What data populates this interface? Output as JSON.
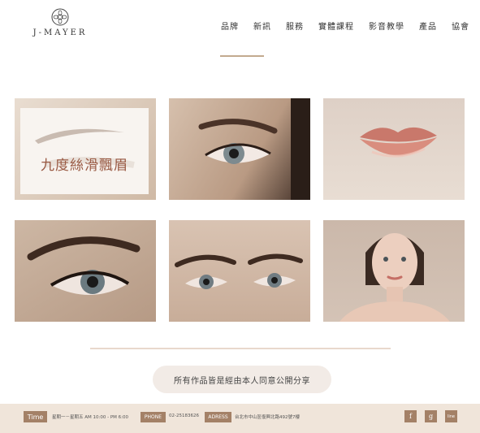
{
  "brand": {
    "name": "J-MAYER"
  },
  "nav": {
    "items": [
      "品牌",
      "新訊",
      "服務",
      "實體課程",
      "影音教學",
      "產品",
      "協會"
    ]
  },
  "gallery": {
    "card_text": "九度絲滑飄眉"
  },
  "notice": "所有作品皆是經由本人同意公開分享",
  "footer": {
    "time_label": "Time",
    "time_value": "星期一－星期五 AM 10:00 - PM 6:00",
    "phone_label": "PHONE",
    "phone_value": "02-25183626",
    "address_label": "ADRESS",
    "address_value": "台北市中山區復興北路492號7樓",
    "social": {
      "facebook": "f",
      "google": "g",
      "line": "line"
    }
  },
  "colors": {
    "accent": "#a48167",
    "footer_bg": "#f0e5da",
    "rule": "#c2aa8f"
  }
}
